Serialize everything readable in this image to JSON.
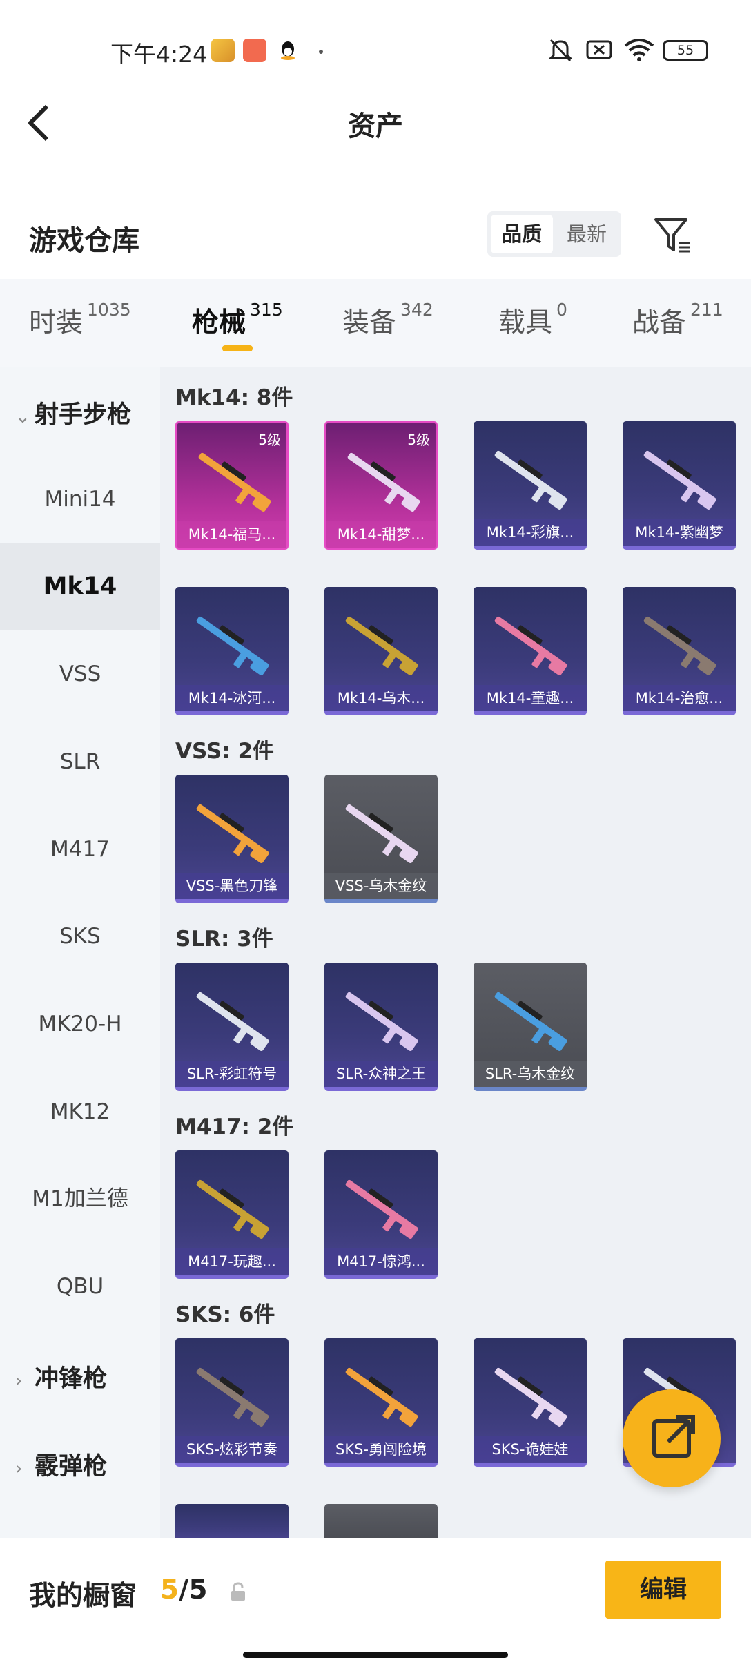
{
  "status_bar": {
    "time": "下午4:24",
    "battery": "55"
  },
  "header": {
    "title": "资产"
  },
  "warehouse": {
    "title": "游戏仓库",
    "sort_options": [
      "品质",
      "最新"
    ]
  },
  "tabs": [
    {
      "label": "时装",
      "count": "1035"
    },
    {
      "label": "枪械",
      "count": "315"
    },
    {
      "label": "装备",
      "count": "342"
    },
    {
      "label": "载具",
      "count": "0"
    },
    {
      "label": "战备",
      "count": "211"
    }
  ],
  "sidebar": {
    "category_open": "射手步枪",
    "items": [
      "Mini14",
      "Mk14",
      "VSS",
      "SLR",
      "M417",
      "SKS",
      "MK20-H",
      "MK12",
      "M1加兰德",
      "QBU"
    ],
    "category_2": "冲锋枪",
    "category_3": "霰弹枪"
  },
  "sections": [
    {
      "title": "Mk14: 8件",
      "items": [
        {
          "label": "Mk14-福马...",
          "level": "5级"
        },
        {
          "label": "Mk14-甜梦...",
          "level": "5级"
        },
        {
          "label": "Mk14-彩旗..."
        },
        {
          "label": "Mk14-紫幽梦"
        },
        {
          "label": "Mk14-冰河..."
        },
        {
          "label": "Mk14-乌木..."
        },
        {
          "label": "Mk14-童趣..."
        },
        {
          "label": "Mk14-治愈..."
        }
      ]
    },
    {
      "title": "VSS: 2件",
      "items": [
        {
          "label": "VSS-黑色刀锋"
        },
        {
          "label": "VSS-乌木金纹"
        }
      ]
    },
    {
      "title": "SLR: 3件",
      "items": [
        {
          "label": "SLR-彩虹符号"
        },
        {
          "label": "SLR-众神之王"
        },
        {
          "label": "SLR-乌木金纹"
        }
      ]
    },
    {
      "title": "M417: 2件",
      "items": [
        {
          "label": "M417-玩趣..."
        },
        {
          "label": "M417-惊鸿..."
        }
      ]
    },
    {
      "title": "SKS: 6件",
      "items": [
        {
          "label": "SKS-炫彩节奏"
        },
        {
          "label": "SKS-勇闯险境"
        },
        {
          "label": "SKS-诡娃娃"
        }
      ]
    }
  ],
  "bottom": {
    "label": "我的橱窗",
    "count_used": "5",
    "count_total": "/5",
    "edit_label": "编辑"
  }
}
